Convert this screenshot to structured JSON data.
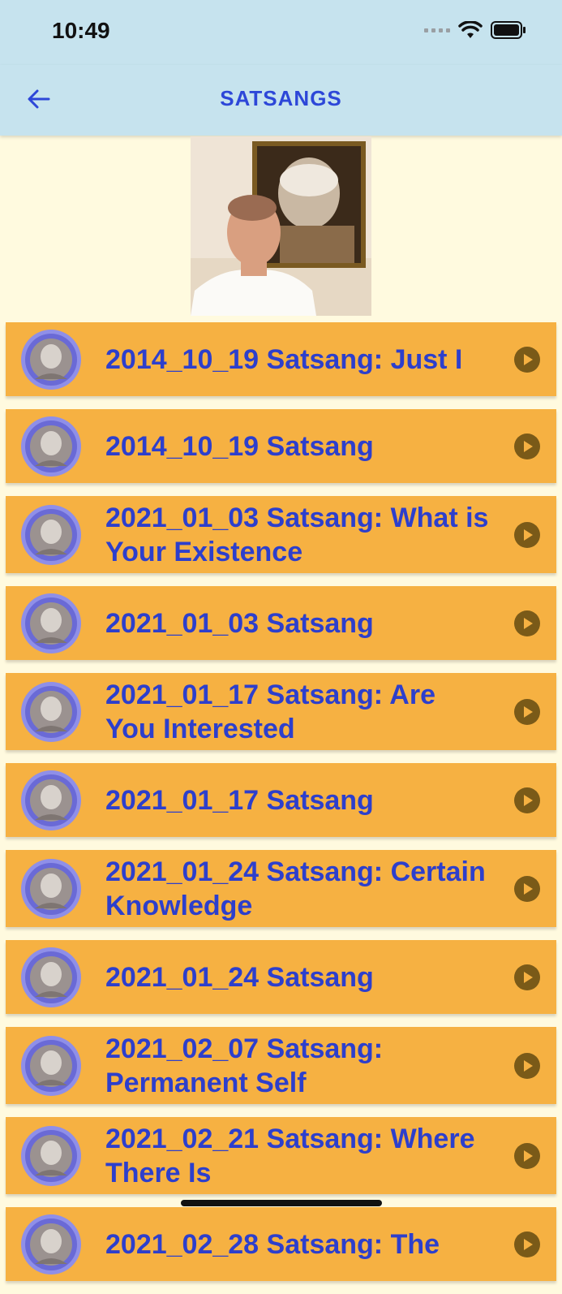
{
  "status_bar": {
    "time": "10:49"
  },
  "nav": {
    "title": "SATSANGS"
  },
  "colors": {
    "nav_bg": "#c6e3ee",
    "accent": "#2d47d8",
    "item_bg": "#f6b142",
    "play": "#7a5a18",
    "page_bg": "#fffadf"
  },
  "items": [
    {
      "label": "2014_10_19 Satsang: Just I"
    },
    {
      "label": "2014_10_19 Satsang"
    },
    {
      "label": "2021_01_03 Satsang: What is Your Existence"
    },
    {
      "label": "2021_01_03 Satsang"
    },
    {
      "label": "2021_01_17 Satsang: Are You Interested"
    },
    {
      "label": "2021_01_17 Satsang"
    },
    {
      "label": "2021_01_24 Satsang: Certain Knowledge"
    },
    {
      "label": "2021_01_24 Satsang"
    },
    {
      "label": "2021_02_07 Satsang: Permanent Self"
    },
    {
      "label": "2021_02_21 Satsang: Where There Is"
    },
    {
      "label": "2021_02_28 Satsang: The"
    }
  ]
}
